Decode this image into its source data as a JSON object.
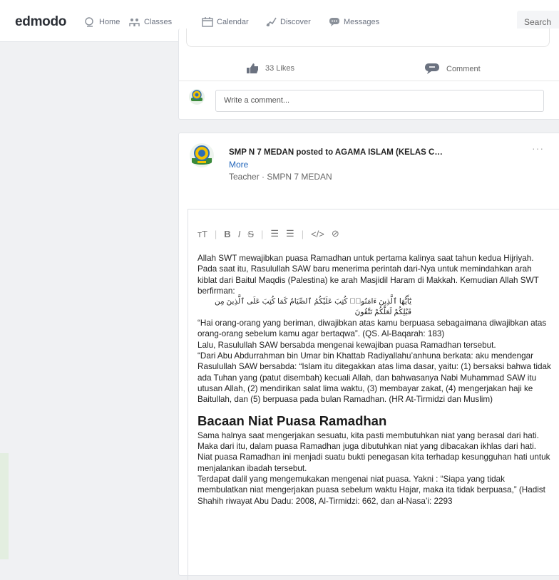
{
  "topbar": {
    "logo": "edmodo",
    "nav": [
      {
        "label": "Home",
        "icon": "home-icon"
      },
      {
        "label": "Classes",
        "icon": "classes-icon"
      },
      {
        "label": "Calendar",
        "icon": "calendar-icon"
      },
      {
        "label": "Discover",
        "icon": "discover-icon"
      },
      {
        "label": "Messages",
        "icon": "messages-icon"
      }
    ],
    "search_label": "Search"
  },
  "previous_post": {
    "likes_label": "33 Likes",
    "comment_label": "Comment",
    "comment_placeholder": "Write a comment..."
  },
  "post": {
    "poster": "SMP N 7 MEDAN posted to AGAMA ISLAM (KELAS C…",
    "more_label": "More",
    "role": "Teacher · SMPN 7 MEDAN",
    "menu_glyph": "···",
    "toolbar": {
      "text_size": "тT",
      "bold": "B",
      "italic": "I",
      "strike": "S",
      "bullets": "☰",
      "numbers": "☰",
      "code": "</>",
      "link": "⊘"
    },
    "paragraph1": "Allah SWT mewajibkan puasa Ramadhan untuk pertama kalinya saat tahun kedua Hijriyah. Pada saat itu, Rasulullah SAW baru menerima perintah dari-Nya untuk memindahkan arah kiblat dari Baitul Maqdis (Palestina) ke arah Masjidil Haram di Makkah. Kemudian Allah SWT berfirman:",
    "arabic": "يَٰٓأَيُّهَا ٱلَّذِينَ ءَامَنُوا۟ كُتِبَ عَلَيْكُمُ ٱلصِّيَامُ كَمَا كُتِبَ عَلَى ٱلَّذِينَ مِن قَبْلِكُمْ لَعَلَّكُمْ تَتَّقُونَ",
    "paragraph2": "“Hai orang-orang yang beriman, diwajibkan atas kamu berpuasa sebagaimana diwajibkan atas orang-orang sebelum kamu agar bertaqwa”. (QS. Al-Baqarah: 183)",
    "paragraph3": "Lalu, Rasulullah SAW bersabda mengenai kewajiban puasa Ramadhan tersebut.",
    "paragraph4": "“Dari Abu Abdurrahman bin Umar bin Khattab Radiyallahu’anhuna berkata: aku mendengar Rasulullah SAW bersabda: “Islam itu ditegakkan atas lima dasar, yaitu: (1) bersaksi bahwa tidak ada Tuhan yang (patut disembah) kecuali Allah, dan bahwasanya Nabi Muhammad SAW itu utusan Allah, (2) mendirikan salat lima waktu, (3) membayar zakat, (4) mengerjakan haji ke Baitullah, dan (5) berpuasa pada bulan Ramadhan. (HR At-Tirmidzi dan Muslim)",
    "heading": "Bacaan Niat Puasa Ramadhan",
    "paragraph5": "Sama halnya saat mengerjakan sesuatu, kita pasti membutuhkan niat yang berasal dari hati. Maka dari itu, dalam puasa Ramadhan juga dibutuhkan niat yang dibacakan ikhlas dari hati. Niat puasa Ramadhan ini menjadi suatu bukti penegasan kita terhadap kesungguhan hati untuk menjalankan ibadah tersebut.",
    "paragraph6": "Terdapat dalil yang mengemukakan mengenai niat puasa. Yakni : “Siapa yang tidak membulatkan niat mengerjakan puasa sebelum waktu Hajar, maka ita tidak berpuasa,” (Hadist Shahih riwayat Abu Dadu: 2008, Al-Tirmidzi: 662, dan al-Nasa’i: 2293"
  },
  "colors": {
    "accent": "#2266bb",
    "badge_green": "#3a8a3a",
    "badge_yellow": "#f2c200"
  }
}
